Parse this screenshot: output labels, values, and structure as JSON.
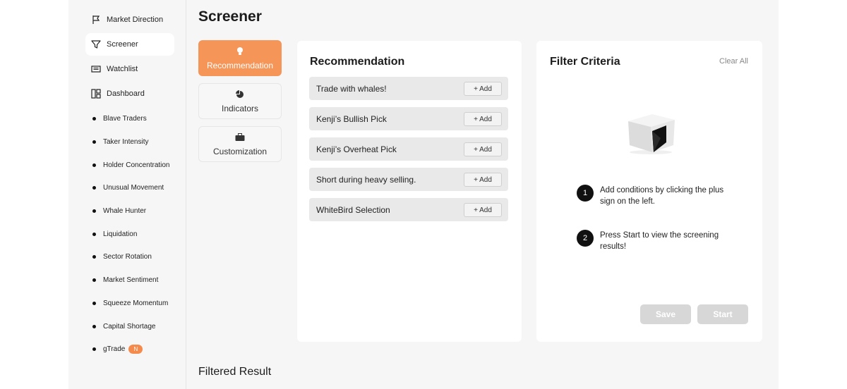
{
  "sidebar": {
    "main_items": [
      {
        "label": "Market Direction",
        "icon": "flag-icon"
      },
      {
        "label": "Screener",
        "icon": "filter-icon"
      },
      {
        "label": "Watchlist",
        "icon": "list-icon"
      },
      {
        "label": "Dashboard",
        "icon": "dashboard-icon"
      }
    ],
    "sub_items": [
      {
        "label": "Blave Traders"
      },
      {
        "label": "Taker Intensity"
      },
      {
        "label": "Holder Concentration"
      },
      {
        "label": "Unusual Movement"
      },
      {
        "label": "Whale Hunter"
      },
      {
        "label": "Liquidation"
      },
      {
        "label": "Sector Rotation"
      },
      {
        "label": "Market Sentiment"
      },
      {
        "label": "Squeeze Momentum"
      },
      {
        "label": "Capital Shortage"
      },
      {
        "label": "gTrade",
        "badge": "N"
      }
    ]
  },
  "page": {
    "title": "Screener",
    "filtered_title": "Filtered Result"
  },
  "tabs": [
    {
      "label": "Recommendation",
      "icon": "lightbulb-icon"
    },
    {
      "label": "Indicators",
      "icon": "pie-chart-icon"
    },
    {
      "label": "Customization",
      "icon": "briefcase-icon"
    }
  ],
  "recommendation": {
    "title": "Recommendation",
    "add_label": "+ Add",
    "items": [
      {
        "label": "Trade with whales!"
      },
      {
        "label": "Kenji’s Bullish Pick"
      },
      {
        "label": "Kenji’s Overheat Pick"
      },
      {
        "label": "Short during heavy selling."
      },
      {
        "label": "WhiteBird Selection"
      }
    ]
  },
  "filter": {
    "title": "Filter Criteria",
    "clear_all": "Clear All",
    "steps": [
      {
        "num": "1",
        "text": "Add conditions by clicking the plus sign on the left."
      },
      {
        "num": "2",
        "text": "Press Start to view the screening results!"
      }
    ],
    "save_label": "Save",
    "start_label": "Start"
  },
  "colors": {
    "accent": "#f59558",
    "badge": "#f48a4b",
    "disabled_button": "#d7d7d7"
  }
}
